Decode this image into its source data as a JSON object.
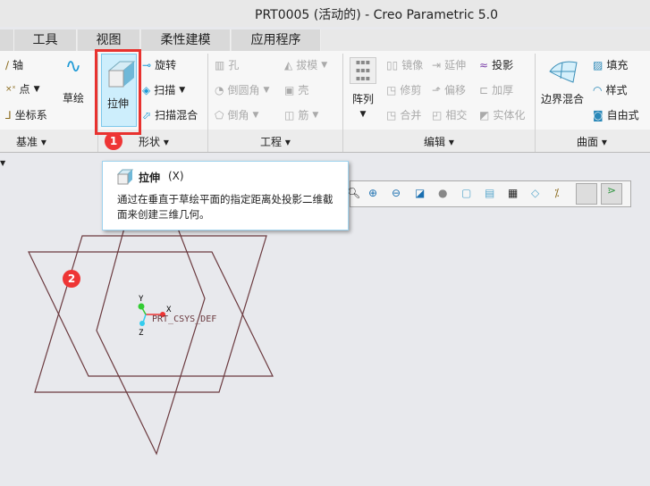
{
  "window": {
    "title": "PRT0005 (活动的) - Creo Parametric 5.0"
  },
  "tabs": [
    "工具",
    "视图",
    "柔性建模",
    "应用程序"
  ],
  "ribbon": {
    "datum": {
      "items": [
        "轴",
        "点",
        "坐标系"
      ],
      "sketch": "草绘",
      "label": "基准"
    },
    "shapes": {
      "extrude": "拉伸",
      "items": [
        "旋转",
        "扫描",
        "扫描混合"
      ],
      "label": "形状"
    },
    "engineering": {
      "items": [
        "孔",
        "倒圆角",
        "倒角",
        "拔模",
        "壳",
        "筋"
      ],
      "label": "工程"
    },
    "editing": {
      "pattern": "阵列",
      "items": [
        "镜像",
        "修剪",
        "合并",
        "延伸",
        "偏移",
        "相交",
        "投影",
        "加厚",
        "实体化"
      ],
      "label": "编辑"
    },
    "surfaces": {
      "boundary": "边界混合",
      "items": [
        "填充",
        "样式",
        "自由式"
      ],
      "label": "曲面"
    }
  },
  "tooltip": {
    "title": "拉伸",
    "shortcut": "(X)",
    "description": "通过在垂直于草绘平面的指定距离处投影二维截面来创建三维几何。"
  },
  "annotations": [
    "1",
    "2"
  ],
  "canvas": {
    "csys_label": "PRT_CSYS_DEF",
    "axes": [
      "X",
      "Y",
      "Z"
    ],
    "plane_color": "#6b3a3f"
  },
  "colors": {
    "highlight": "#e8322f",
    "badge": "#ee3535"
  }
}
